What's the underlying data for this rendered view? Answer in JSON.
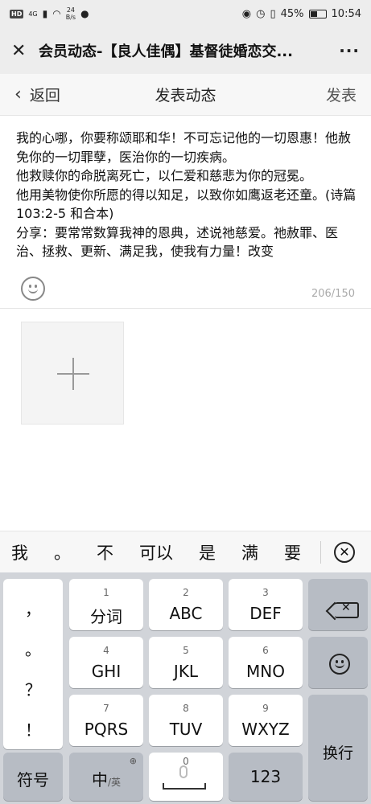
{
  "status_bar": {
    "hd": "HD",
    "signal": "4G",
    "speed_value": "24",
    "speed_unit": "B/s",
    "battery": "45%",
    "battery_level": 0.45,
    "time": "10:54"
  },
  "title_bar": {
    "close_icon": "close-icon",
    "title": "会员动态-【良人佳偶】基督徒婚恋交...",
    "more": "···"
  },
  "nav": {
    "back_label": "返回",
    "title": "发表动态",
    "publish_label": "发表"
  },
  "editor": {
    "text": "我的心哪，你要称颂耶和华！不可忘记他的一切恩惠！他赦免你的一切罪孽，医治你的一切疾病。\n他救赎你的命脱离死亡，以仁爱和慈悲为你的冠冕。\n他用美物使你所愿的得以知足，以致你如鹰返老还童。(诗篇 103:2-5 和合本)\n分享：要常常数算我神的恩典，述说祂慈爱。祂赦罪、医治、拯救、更新、满足我，使我有力量！改变",
    "counter": "206/150"
  },
  "candidates": [
    "我",
    "。",
    "不",
    "可以",
    "是",
    "满",
    "要"
  ],
  "keyboard": {
    "punctuation": [
      "，",
      "。",
      "？",
      "！"
    ],
    "keys": [
      {
        "num": "1",
        "label": "分词"
      },
      {
        "num": "2",
        "label": "ABC"
      },
      {
        "num": "3",
        "label": "DEF"
      },
      {
        "num": "4",
        "label": "GHI"
      },
      {
        "num": "5",
        "label": "JKL"
      },
      {
        "num": "6",
        "label": "MNO"
      },
      {
        "num": "7",
        "label": "PQRS"
      },
      {
        "num": "8",
        "label": "TUV"
      },
      {
        "num": "9",
        "label": "WXYZ"
      }
    ],
    "enter_label": "换行",
    "symbol_label": "符号",
    "lang_main": "中",
    "lang_alt": "/英",
    "space_num": "0",
    "numeric_label": "123"
  }
}
